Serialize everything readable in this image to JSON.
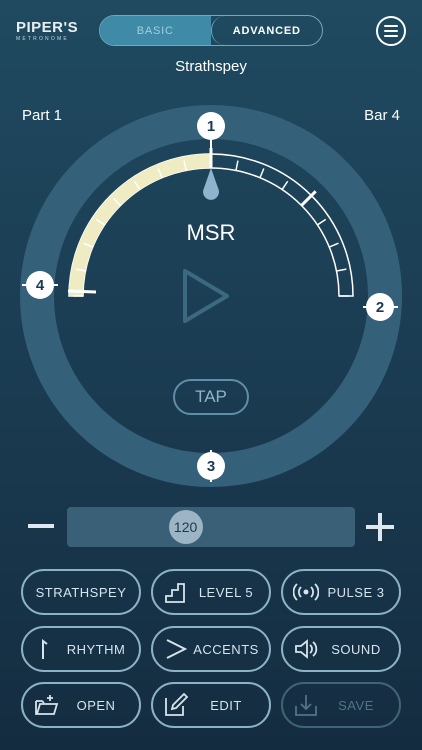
{
  "logo": {
    "line1": "PIPER'S",
    "line2": "METRONOME"
  },
  "mode": {
    "basic_label": "BASIC",
    "advanced_label": "ADVANCED",
    "selected": "ADVANCED"
  },
  "tune_type": "Strathspey",
  "part_label": "Part 1",
  "bar_label": "Bar 4",
  "dial": {
    "markers": [
      "1",
      "2",
      "3",
      "4"
    ],
    "style_label": "MSR",
    "tap_label": "TAP",
    "progress_fraction": 0.6
  },
  "tempo": {
    "value": "120",
    "min": 40,
    "max": 240
  },
  "buttons": [
    {
      "name": "strathspey-button",
      "label": "STRATHSPEY",
      "icon": ""
    },
    {
      "name": "level-button",
      "label": "LEVEL 5",
      "icon": "stairs-icon"
    },
    {
      "name": "pulse-button",
      "label": "PULSE 3",
      "icon": "pulse-icon"
    },
    {
      "name": "rhythm-button",
      "label": "RHYTHM",
      "icon": "note-icon"
    },
    {
      "name": "accents-button",
      "label": "ACCENTS",
      "icon": "accent-icon"
    },
    {
      "name": "sound-button",
      "label": "SOUND",
      "icon": "speaker-icon"
    },
    {
      "name": "open-button",
      "label": "OPEN",
      "icon": "folder-icon"
    },
    {
      "name": "edit-button",
      "label": "EDIT",
      "icon": "edit-icon"
    },
    {
      "name": "save-button",
      "label": "SAVE",
      "icon": "save-icon"
    }
  ],
  "colors": {
    "background": "#1f4a60",
    "arc_fill": "#efebc2",
    "ring": "#35607a",
    "button_border": "#8cb2c6",
    "disabled": "#3f6478"
  }
}
